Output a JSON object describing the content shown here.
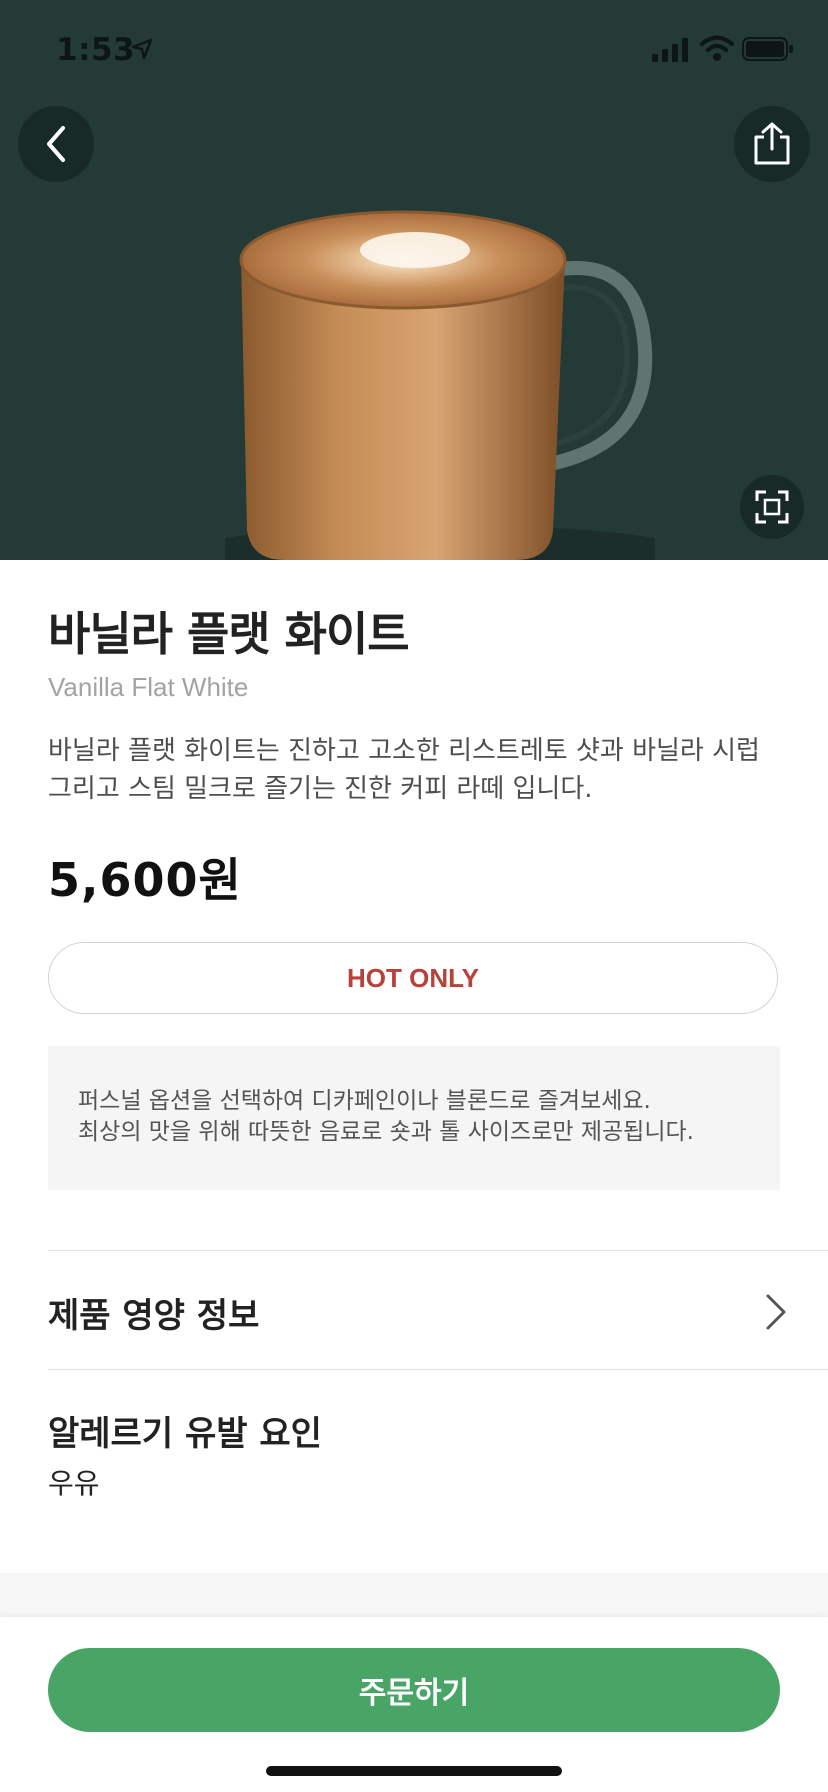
{
  "status_bar": {
    "time": "1:53"
  },
  "product": {
    "name_ko": "바닐라 플랫 화이트",
    "name_en": "Vanilla Flat White",
    "description_line1": "바닐라 플랫 화이트는 진하고 고소한 리스트레토 샷과 바닐라 시럽",
    "description_line2": "그리고 스팀 밀크로 즐기는 진한 커피 라떼 입니다.",
    "price": "5,600원",
    "temperature_badge": "HOT ONLY",
    "info_line1": "퍼스널 옵션을 선택하여 디카페인이나 블론드로 즐겨보세요.",
    "info_line2": "최상의 맛을 위해 따뜻한 음료로 숏과 톨 사이즈로만 제공됩니다."
  },
  "sections": {
    "nutrition_label": "제품 영양 정보",
    "allergy_title": "알레르기 유발 요인",
    "allergy_value": "우유"
  },
  "actions": {
    "order_label": "주문하기"
  },
  "icons": {
    "back": "chevron-left-icon",
    "share": "share-icon",
    "expand": "fullscreen-icon",
    "nutrition_arrow": "chevron-right-icon"
  },
  "colors": {
    "hero_background": "#233a36",
    "accent_green": "#49a566",
    "hot_red": "#b8413a"
  }
}
